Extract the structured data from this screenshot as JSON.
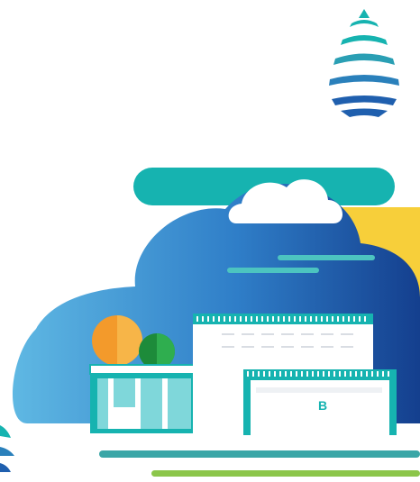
{
  "scene": {
    "subject": "office-building-under-cloud",
    "building_sign": "B"
  },
  "colors": {
    "background": "#ffffff",
    "teal": "#16b3b0",
    "teal_light": "#5dc7c4",
    "blue": "#1f5fae",
    "blue_light": "#4aa6d8",
    "navy": "#163f85",
    "yellow": "#f7cf3a",
    "orange": "#f39a2b",
    "green_dark": "#1d8b3a",
    "green_light": "#7fc04a",
    "gray": "#d9dde3"
  },
  "icons": {
    "water_drop": "water-drop-icon",
    "cloud_small": "cloud-icon",
    "building": "office-building-icon"
  }
}
